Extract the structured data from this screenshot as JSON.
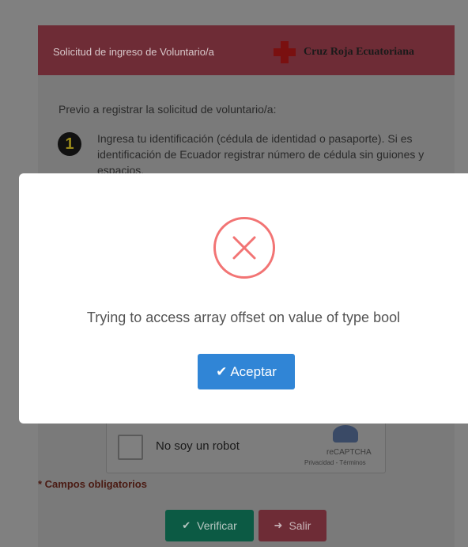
{
  "header": {
    "title": "Solicitud de ingreso de Voluntario/a",
    "brand": "Cruz Roja Ecuatoriana"
  },
  "intro": "Previo a registrar la solicitud de voluntario/a:",
  "step": {
    "number": "1",
    "text": "Ingresa tu identificación (cédula de identidad o pasaporte). Si es identificación de Ecuador registrar número de cédula sin guiones y espacios."
  },
  "recaptcha": {
    "label": "No soy un robot",
    "name": "reCAPTCHA",
    "links": "Privacidad - Términos"
  },
  "required_note": "* Campos obligatorios",
  "buttons": {
    "verify": "Verificar",
    "exit": "Salir",
    "accept": "Aceptar"
  },
  "modal": {
    "message": "Trying to access array offset on value of type bool"
  },
  "colors": {
    "error_red": "#f27474",
    "accept_blue": "#3085d6",
    "header_red": "#dc3545",
    "verify_green": "#17a673"
  }
}
